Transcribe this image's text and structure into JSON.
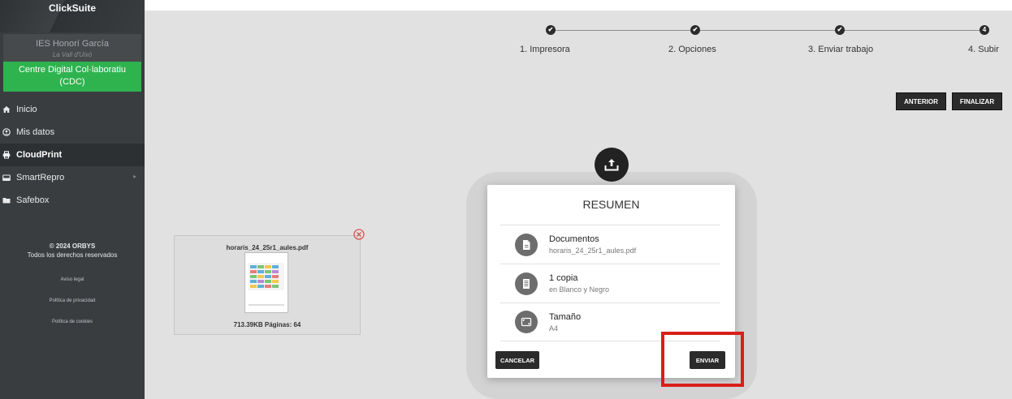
{
  "sidebar": {
    "brand": "ClickSuite",
    "org_name": "IES Honorí García",
    "org_city": "La Vall d'Uixó",
    "cdc_button": "Centre Digital Col·laboratiu (CDC)",
    "items": [
      {
        "label": "Inicio",
        "icon": "home-icon"
      },
      {
        "label": "Mis datos",
        "icon": "user-icon"
      },
      {
        "label": "CloudPrint",
        "icon": "printer-icon",
        "active": true
      },
      {
        "label": "SmartRepro",
        "icon": "copier-icon",
        "has_submenu": true
      },
      {
        "label": "Safebox",
        "icon": "folder-icon"
      }
    ],
    "copyright": "© 2024 ORBYS",
    "rights": "Todos los derechos reservados",
    "links": [
      "Aviso legal",
      "Política de privacidad",
      "Política de cookies"
    ]
  },
  "stepper": {
    "steps": [
      {
        "label": "1. Impresora",
        "mark": "✔"
      },
      {
        "label": "2. Opciones",
        "mark": "✔"
      },
      {
        "label": "3. Enviar trabajo",
        "mark": "✔"
      },
      {
        "label": "4. Subir",
        "mark": "4"
      }
    ]
  },
  "toolbar": {
    "prev_label": "ANTERIOR",
    "finish_label": "FINALIZAR"
  },
  "file": {
    "name": "horaris_24_25r1_aules.pdf",
    "meta": "713.39KB Páginas: 64"
  },
  "modal": {
    "title": "RESUMEN",
    "rows": [
      {
        "head": "Documentos",
        "sub": "horaris_24_25r1_aules.pdf",
        "icon": "document-icon"
      },
      {
        "head": "1 copia",
        "sub": "en Blanco y Negro",
        "icon": "copies-icon"
      },
      {
        "head": "Tamaño",
        "sub": "A4",
        "icon": "page-size-icon"
      }
    ],
    "cancel_label": "CANCELAR",
    "send_label": "ENVIAR"
  },
  "colors": {
    "sidebar_bg": "#3a3d40",
    "accent_green": "#2eb34f",
    "dark_button": "#2b2b2b",
    "highlight_red": "#d81f18"
  }
}
